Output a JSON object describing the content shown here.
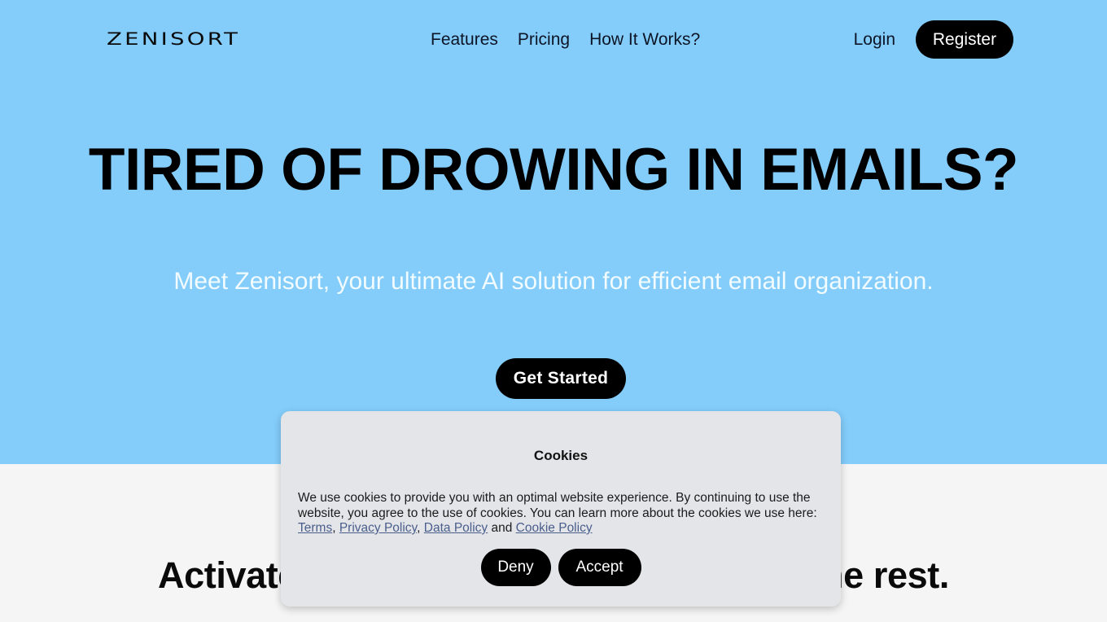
{
  "brand": {
    "logo_text": "ZENISORT"
  },
  "nav": {
    "links": [
      {
        "label": "Features"
      },
      {
        "label": "Pricing"
      },
      {
        "label": "How It Works?"
      }
    ],
    "login_label": "Login",
    "register_label": "Register"
  },
  "hero": {
    "title": "TIRED OF DROWING IN EMAILS?",
    "subtitle": "Meet Zenisort, your ultimate AI solution for efficient email organization.",
    "cta_label": "Get Started",
    "background_color": "#84cdfb"
  },
  "section_two": {
    "title": "Activate, customize, and let AI handle the rest.",
    "background_color": "#f5f5f5"
  },
  "cookie_dialog": {
    "title": "Cookies",
    "text_part_1": "We use cookies to provide you with an optimal website experience. By continuing to use the website, you agree to the use of cookies. You can learn more about the cookies we use here: ",
    "link_terms": "Terms",
    "separator_1": ", ",
    "link_privacy": "Privacy Policy",
    "separator_2": ", ",
    "link_data": "Data Policy",
    "separator_3": " and ",
    "link_cookie": "Cookie Policy",
    "deny_label": "Deny",
    "accept_label": "Accept",
    "background_color": "#e4e5e9",
    "link_color": "#4a5e8c"
  }
}
